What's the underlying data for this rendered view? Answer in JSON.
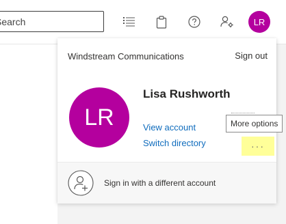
{
  "header": {
    "search_placeholder": "Search",
    "icons": [
      "list-icon",
      "clipboard-icon",
      "help-icon",
      "person-settings-icon"
    ],
    "avatar_initials": "LR",
    "avatar_color": "#b4009e"
  },
  "account": {
    "organization": "Windstream Communications",
    "sign_out_label": "Sign out",
    "initials": "LR",
    "display_name": "Lisa Rushworth",
    "view_account_label": "View account",
    "switch_directory_label": "Switch directory",
    "more_options_label": "···",
    "more_options_tooltip": "More options",
    "sign_in_different_label": "Sign in with a different account",
    "link_color": "#0f6cbd",
    "highlight_color": "#ffff99"
  }
}
